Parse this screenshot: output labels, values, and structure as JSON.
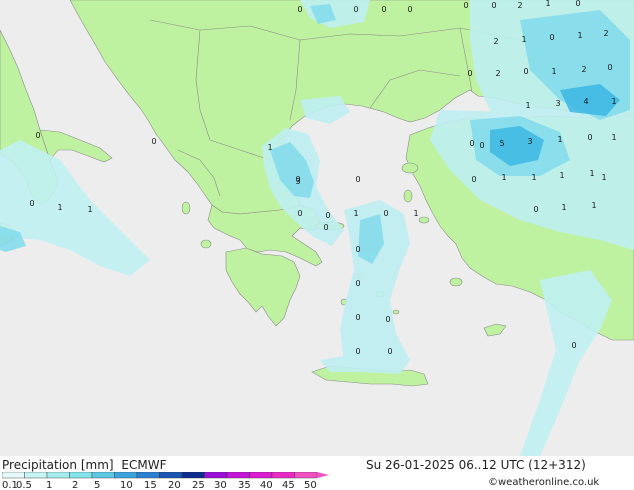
{
  "footer": {
    "product": "Precipitation [mm]",
    "model": "ECMWF",
    "valid_time": "Su 26-01-2025 06..12 UTC (12+312)",
    "credit": "©weatheronline.co.uk"
  },
  "legend": {
    "labels": [
      "0.1",
      "0.5",
      "1",
      "2",
      "5",
      "10",
      "15",
      "20",
      "25",
      "30",
      "35",
      "40",
      "45",
      "50"
    ],
    "colors": [
      "#e6f9f9",
      "#c6f3f3",
      "#a4ecec",
      "#82e3ea",
      "#5cc8e4",
      "#3ca4dc",
      "#2a7fd2",
      "#1a56b4",
      "#0d2e8c",
      "#9a10d8",
      "#c416d8",
      "#dc1cd0",
      "#ea2ac6",
      "#f050c0"
    ]
  },
  "colors": {
    "land": "#bff2a0",
    "sea": "#ededed",
    "precip_light": "#bfeff2",
    "precip_medium": "#85dcec",
    "precip_heavy": "#3cb8e4"
  },
  "map_labels": [
    {
      "id": "l1",
      "text": "0"
    },
    {
      "id": "l2",
      "text": "0"
    },
    {
      "id": "l3",
      "text": "0"
    },
    {
      "id": "l4",
      "text": "0"
    },
    {
      "id": "l5",
      "text": "0"
    },
    {
      "id": "l6",
      "text": "0"
    },
    {
      "id": "l7",
      "text": "2"
    },
    {
      "id": "l8",
      "text": "1"
    },
    {
      "id": "l9",
      "text": "0"
    },
    {
      "id": "l10",
      "text": "2"
    },
    {
      "id": "l11",
      "text": "1"
    },
    {
      "id": "l12",
      "text": "0"
    },
    {
      "id": "l13",
      "text": "1"
    },
    {
      "id": "l14",
      "text": "2"
    },
    {
      "id": "l15",
      "text": "0"
    },
    {
      "id": "l16",
      "text": "2"
    },
    {
      "id": "l17",
      "text": "0"
    },
    {
      "id": "l18",
      "text": "1"
    },
    {
      "id": "l19",
      "text": "2"
    },
    {
      "id": "l20",
      "text": "0"
    },
    {
      "id": "l21",
      "text": "1"
    },
    {
      "id": "l22",
      "text": "3"
    },
    {
      "id": "l23",
      "text": "4"
    },
    {
      "id": "l24",
      "text": "1"
    },
    {
      "id": "l25",
      "text": "0"
    },
    {
      "id": "l26",
      "text": "0"
    },
    {
      "id": "l27",
      "text": "5"
    },
    {
      "id": "l28",
      "text": "3"
    },
    {
      "id": "l29",
      "text": "1"
    },
    {
      "id": "l30",
      "text": "0"
    },
    {
      "id": "l31",
      "text": "1"
    },
    {
      "id": "l32",
      "text": "0"
    },
    {
      "id": "l33",
      "text": "1"
    },
    {
      "id": "l34",
      "text": "1"
    },
    {
      "id": "l35",
      "text": "1"
    },
    {
      "id": "l36",
      "text": "1"
    },
    {
      "id": "l37",
      "text": "1"
    },
    {
      "id": "l38",
      "text": "0"
    },
    {
      "id": "l39",
      "text": "0"
    },
    {
      "id": "l40",
      "text": "1"
    },
    {
      "id": "l41",
      "text": "0"
    },
    {
      "id": "l42",
      "text": "3"
    },
    {
      "id": "l43",
      "text": "0"
    },
    {
      "id": "l44",
      "text": "0"
    },
    {
      "id": "l45",
      "text": "0"
    },
    {
      "id": "l46",
      "text": "1"
    },
    {
      "id": "l47",
      "text": "0"
    },
    {
      "id": "l48",
      "text": "1"
    },
    {
      "id": "l49",
      "text": "1"
    },
    {
      "id": "l50",
      "text": "1"
    },
    {
      "id": "l51",
      "text": "0"
    },
    {
      "id": "l52",
      "text": "0"
    },
    {
      "id": "l53",
      "text": "1"
    },
    {
      "id": "l54",
      "text": "1"
    },
    {
      "id": "l55",
      "text": "0"
    },
    {
      "id": "l56",
      "text": "0"
    },
    {
      "id": "l57",
      "text": "0"
    },
    {
      "id": "l58",
      "text": "0"
    },
    {
      "id": "l59",
      "text": "0"
    },
    {
      "id": "l60",
      "text": "0"
    },
    {
      "id": "l61",
      "text": "0"
    },
    {
      "id": "l62",
      "text": "0"
    }
  ]
}
